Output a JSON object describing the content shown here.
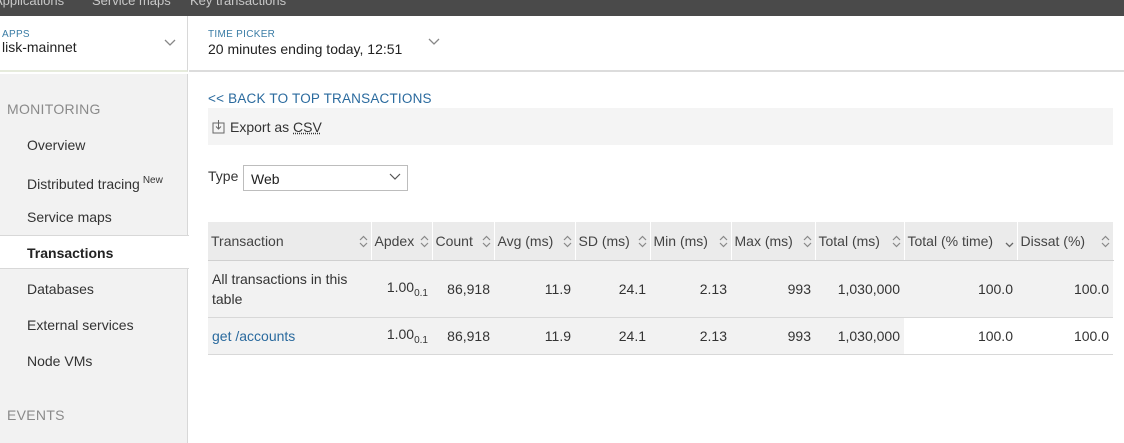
{
  "topnav": {
    "items": [
      "Applications",
      "Service maps",
      "Key transactions"
    ]
  },
  "apps": {
    "label": "APPS",
    "value": "lisk-mainnet"
  },
  "time_picker": {
    "label": "TIME PICKER",
    "value": "20 minutes ending today, 12:51"
  },
  "sidebar": {
    "monitoring_heading": "MONITORING",
    "items": [
      {
        "label": "Overview",
        "badge": ""
      },
      {
        "label": "Distributed tracing",
        "badge": "New"
      },
      {
        "label": "Service maps",
        "badge": ""
      },
      {
        "label": "Transactions",
        "badge": ""
      },
      {
        "label": "Databases",
        "badge": ""
      },
      {
        "label": "External services",
        "badge": ""
      },
      {
        "label": "Node VMs",
        "badge": ""
      }
    ],
    "events_heading": "EVENTS"
  },
  "main": {
    "back_link": "<< BACK TO TOP TRANSACTIONS",
    "export_prefix": "Export as",
    "export_format": "CSV",
    "type_label": "Type",
    "type_value": "Web"
  },
  "table": {
    "headers": [
      "Transaction",
      "Apdex",
      "Count",
      "Avg (ms)",
      "SD (ms)",
      "Min (ms)",
      "Max (ms)",
      "Total (ms)",
      "Total (% time)",
      "Dissat (%)"
    ],
    "rows": [
      {
        "name": "All transactions in this table",
        "apdex": "1.00",
        "apdex_t": "0.1",
        "count": "86,918",
        "avg": "11.9",
        "sd": "24.1",
        "min": "2.13",
        "max": "993",
        "total": "1,030,000",
        "total_pct": "100.0",
        "dissat": "100.0"
      },
      {
        "name": "get /accounts",
        "apdex": "1.00",
        "apdex_t": "0.1",
        "count": "86,918",
        "avg": "11.9",
        "sd": "24.1",
        "min": "2.13",
        "max": "993",
        "total": "1,030,000",
        "total_pct": "100.0",
        "dissat": "100.0"
      }
    ]
  }
}
